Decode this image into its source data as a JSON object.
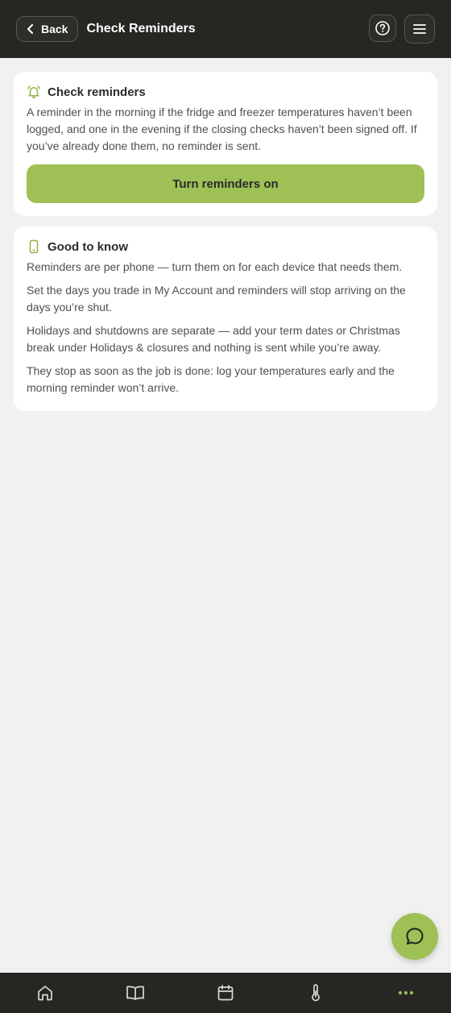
{
  "header": {
    "back_label": "Back",
    "title": "Check Reminders",
    "help_icon": "help-circle-icon",
    "menu_icon": "hamburger-menu-icon"
  },
  "reminders_card": {
    "icon": "bell-icon",
    "title": "Check reminders",
    "text": "A reminder in the morning if the fridge and freezer temperatures haven’t been logged, and one in the evening if the closing checks haven’t been signed off. If you’ve already done them, no reminder is sent.",
    "button_label": "Turn reminders on"
  },
  "info_card": {
    "icon": "phone-icon",
    "title": "Good to know",
    "tips": [
      "Reminders are per phone — turn them on for each device that needs them.",
      "Set the days you trade in My Account and reminders will stop arriving on the days you’re shut.",
      "Holidays and shutdowns are separate — add your term dates or Christmas break under Holidays & closures and nothing is sent while you’re away.",
      "They stop as soon as the job is done: log your temperatures early and the morning reminder won’t arrive."
    ]
  },
  "chat_button": {
    "icon": "chat-bubble-icon"
  },
  "bottom_nav": {
    "items": [
      {
        "icon": "home-icon"
      },
      {
        "icon": "book-icon"
      },
      {
        "icon": "calendar-icon"
      },
      {
        "icon": "thermometer-icon"
      },
      {
        "icon": "more-dots-icon",
        "active": true
      }
    ]
  },
  "colors": {
    "header_bg": "#282623",
    "accent": "#9ec055",
    "page_bg": "#f1f1f1",
    "card_bg": "#ffffff"
  }
}
